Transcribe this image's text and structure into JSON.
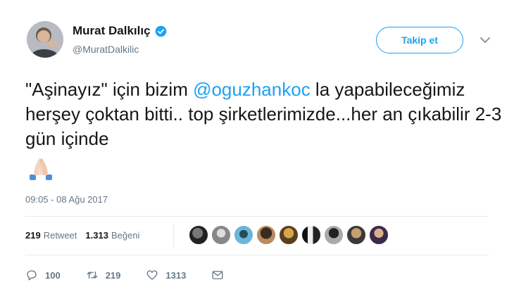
{
  "author": {
    "display_name": "Murat Dalkılıç",
    "handle": "@MuratDalkilic",
    "verified": true
  },
  "follow_button": {
    "label": "Takip et"
  },
  "tweet": {
    "text_part1": "\"Aşinayız\" için bizim ",
    "mention": "@oguzhankoc",
    "text_part2": " la yapabileceğimiz herşey çoktan bitti.. top şirketlerimizde...her an çıkabilir 2-3 gün içinde",
    "emoji": "folded-hands-icon",
    "timestamp": "09:05 - 08 Ağu 2017"
  },
  "stats": {
    "retweets": "219",
    "retweets_label": "Retweet",
    "likes": "1.313",
    "likes_label": "Beğeni"
  },
  "likers_count": 9,
  "actions": {
    "reply_count": "100",
    "retweet_count": "219",
    "like_count": "1313"
  },
  "colors": {
    "accent": "#1da1f2",
    "muted": "#657786",
    "text": "#14171a"
  }
}
